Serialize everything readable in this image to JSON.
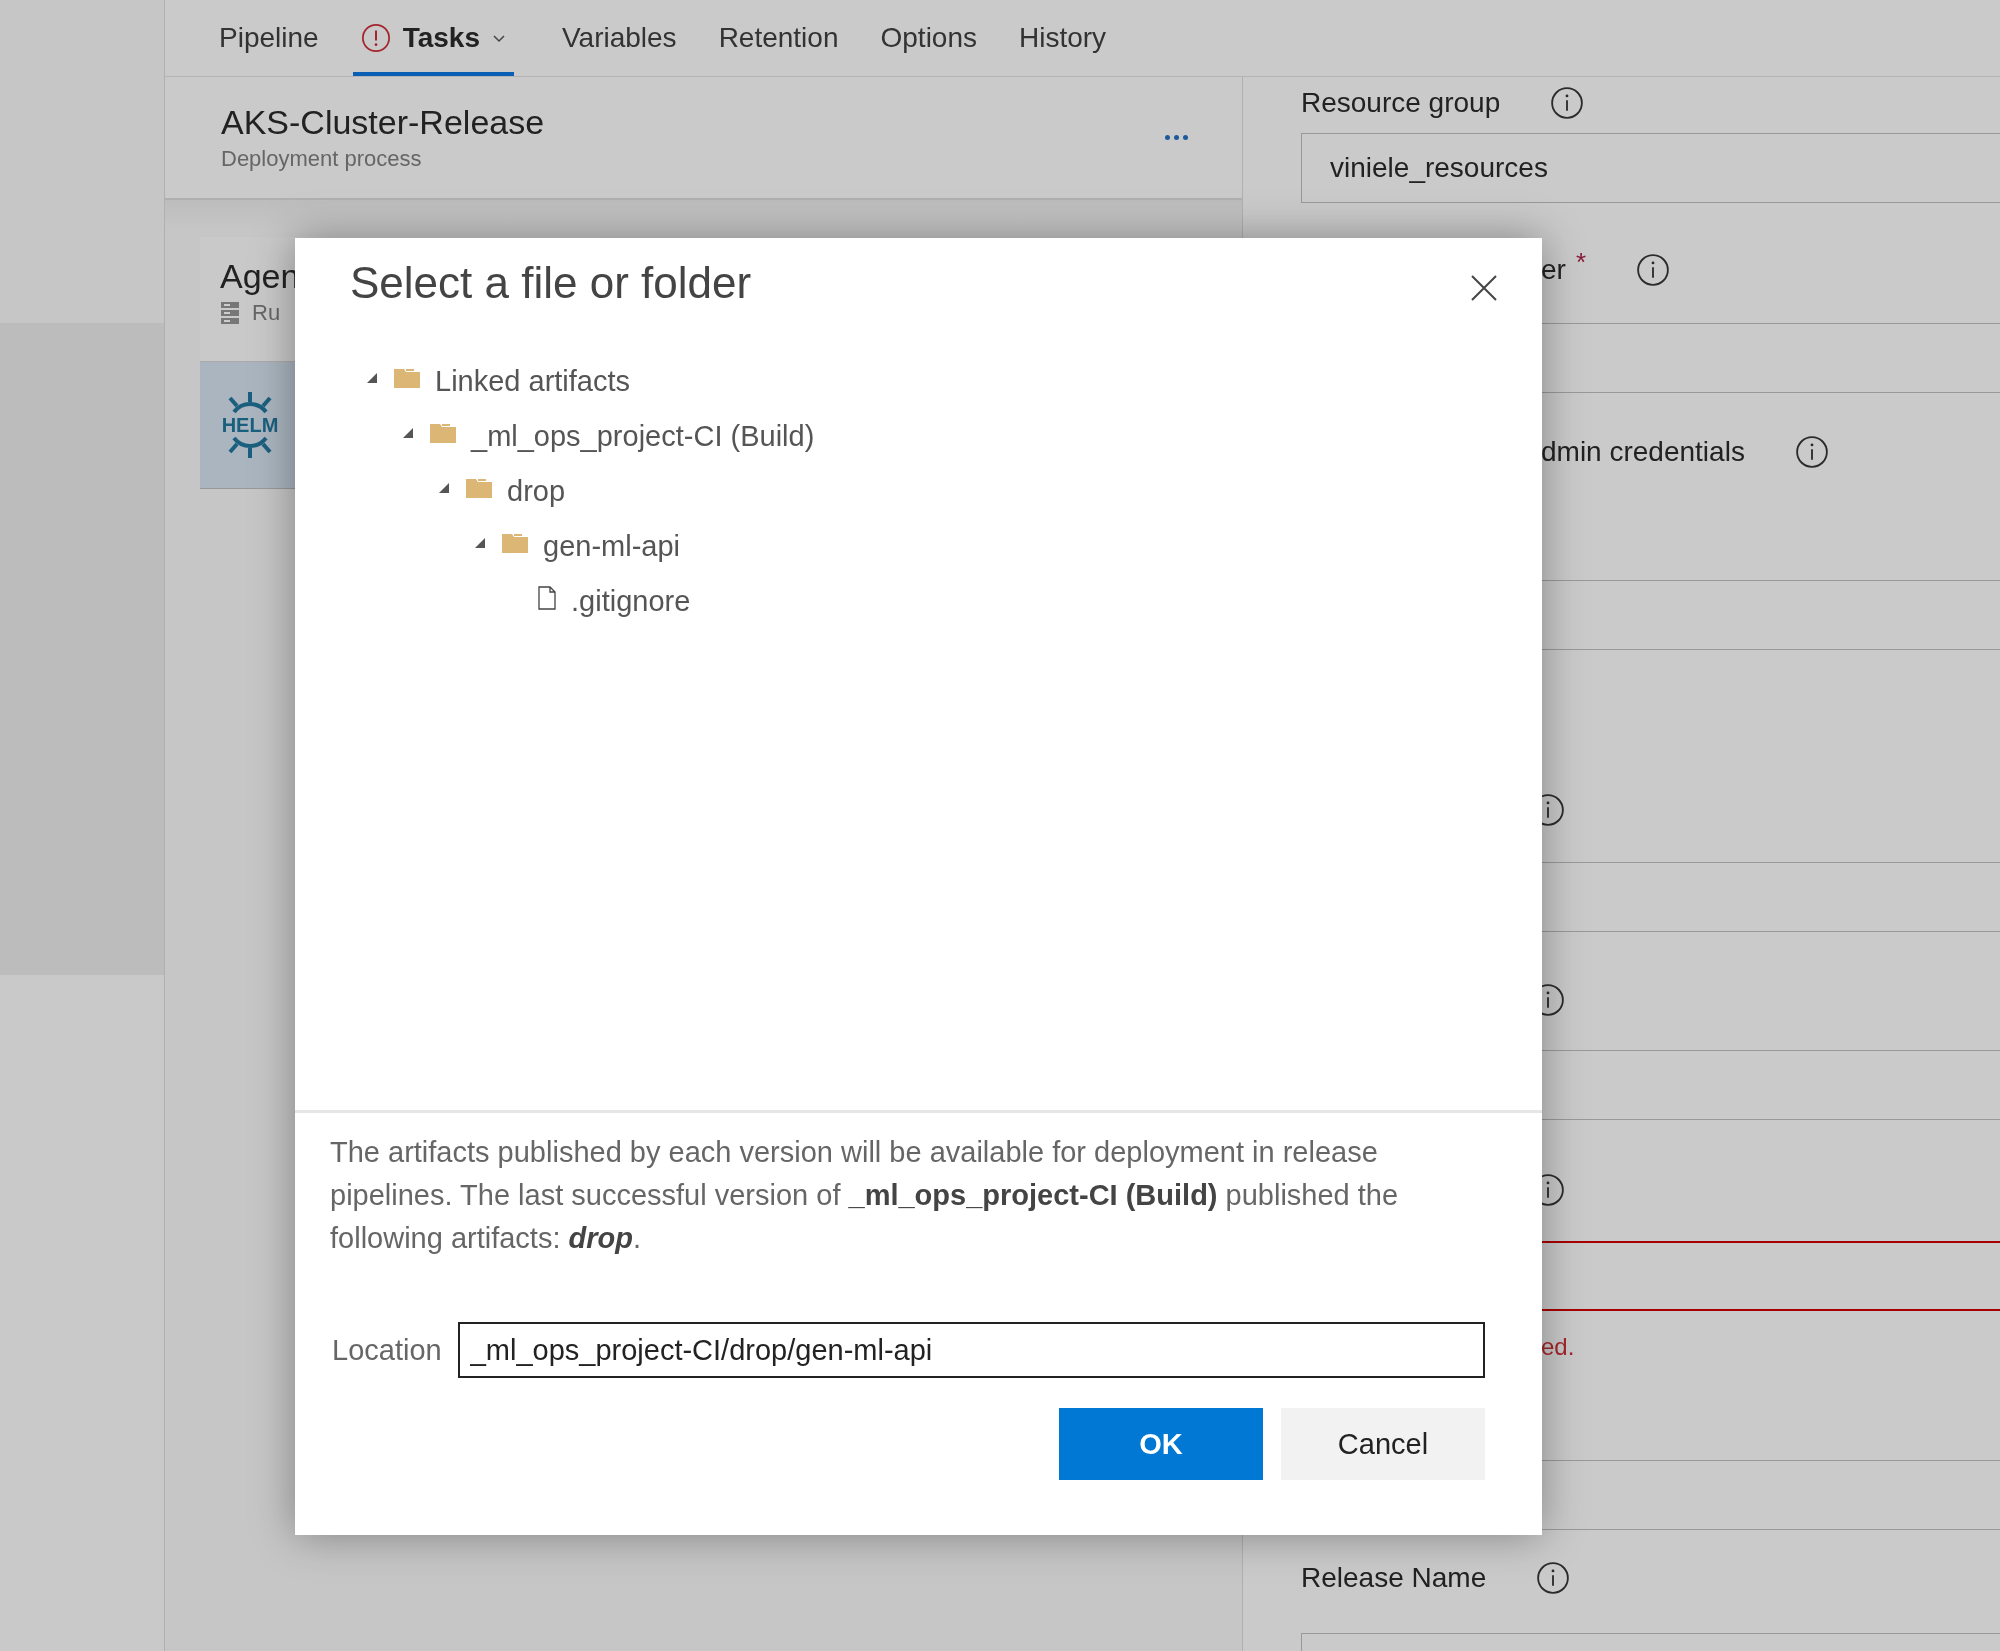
{
  "tabs": [
    {
      "label": "Pipeline",
      "selected": false,
      "warning": false,
      "dropdown": false
    },
    {
      "label": "Tasks",
      "selected": true,
      "warning": true,
      "dropdown": true
    },
    {
      "label": "Variables",
      "selected": false,
      "warning": false,
      "dropdown": false
    },
    {
      "label": "Retention",
      "selected": false,
      "warning": false,
      "dropdown": false
    },
    {
      "label": "Options",
      "selected": false,
      "warning": false,
      "dropdown": false
    },
    {
      "label": "History",
      "selected": false,
      "warning": false,
      "dropdown": false
    }
  ],
  "pipeline": {
    "title": "AKS-Cluster-Release",
    "subtitle": "Deployment process"
  },
  "phase": {
    "name": "Agen",
    "detail": "Ru"
  },
  "task": {
    "logo_text": "HELM",
    "selected": true
  },
  "form": [
    {
      "kind": "label",
      "text": "Resource group",
      "info": true,
      "clipped": false
    },
    {
      "kind": "input",
      "value": "viniele_resources",
      "error": false
    },
    {
      "kind": "label",
      "text": "er",
      "required": "*",
      "info": true,
      "clipped": true
    },
    {
      "kind": "input",
      "error": false
    },
    {
      "kind": "label",
      "text": "dmin credentials",
      "info": true,
      "clipped": true
    },
    {
      "kind": "input",
      "error": false
    },
    {
      "kind": "label",
      "info": true,
      "clipped": true
    },
    {
      "kind": "input",
      "error": false
    },
    {
      "kind": "label",
      "info": true,
      "clipped": true
    },
    {
      "kind": "input",
      "error": false
    },
    {
      "kind": "label",
      "info": true,
      "clipped": true
    },
    {
      "kind": "input",
      "error": true
    },
    {
      "kind": "error",
      "text": "ed.",
      "clipped": true
    },
    {
      "kind": "input",
      "error": false
    },
    {
      "kind": "label",
      "text": "Release Name",
      "info": true,
      "clipped": false
    },
    {
      "kind": "input",
      "error": false
    }
  ],
  "dialog": {
    "title": "Select a file or folder",
    "tree": [
      {
        "label": "Linked artifacts",
        "kind": "folder",
        "expanded": true,
        "children": [
          {
            "label": "_ml_ops_project-CI (Build)",
            "kind": "folder",
            "expanded": true,
            "children": [
              {
                "label": "drop",
                "kind": "folder",
                "expanded": true,
                "children": [
                  {
                    "label": "gen-ml-api",
                    "kind": "folder",
                    "expanded": true,
                    "children": [
                      {
                        "label": ".gitignore",
                        "kind": "file"
                      }
                    ]
                  }
                ]
              }
            ]
          }
        ]
      }
    ],
    "description": "The artifacts published by each version will be available for deployment in release pipelines. The last successful version of **_ml_ops_project-CI (Build)** published the following artifacts: *drop*.",
    "location_label": "Location",
    "location_value": "_ml_ops_project-CI/drop/gen-ml-api",
    "buttons": [
      {
        "label": "OK",
        "kind": "primary"
      },
      {
        "label": "Cancel",
        "kind": "secondary"
      }
    ]
  }
}
